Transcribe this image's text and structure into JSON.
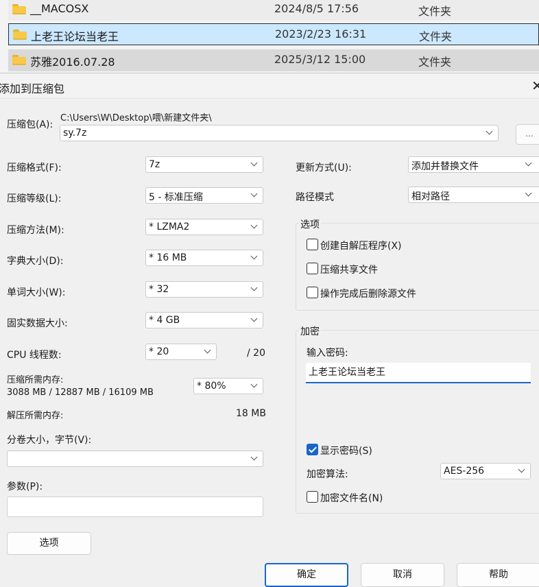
{
  "files": [
    {
      "name": "__MACOSX",
      "date": "2024/8/5 17:56",
      "type": "文件夹",
      "icon": "folder-icon"
    },
    {
      "name": "上老王论坛当老王",
      "date": "2023/2/23 16:31",
      "type": "文件夹",
      "icon": "folder-icon"
    },
    {
      "name": "苏雅2016.07.28",
      "date": "2025/3/12 15:00",
      "type": "文件夹",
      "icon": "folder-icon"
    }
  ],
  "dialog": {
    "title": "添加到压缩包",
    "close": "✕",
    "archive": {
      "label": "压缩包(A):",
      "path": "C:\\Users\\W\\Desktop\\喂\\新建文件夹\\",
      "value": "sy.7z",
      "browse": "..."
    },
    "left": {
      "format": {
        "label": "压缩格式(F):",
        "value": "7z"
      },
      "level": {
        "label": "压缩等级(L):",
        "value": "5 - 标准压缩"
      },
      "method": {
        "label": "压缩方法(M):",
        "value": "*  LZMA2"
      },
      "dict": {
        "label": "字典大小(D):",
        "value": "*  16 MB"
      },
      "word": {
        "label": "单词大小(W):",
        "value": "*  32"
      },
      "solid": {
        "label": "固实数据大小:",
        "value": "*  4 GB"
      },
      "threads": {
        "label": "CPU 线程数:",
        "value": "*  20",
        "max": "/ 20"
      },
      "mem_compress": {
        "label": "压缩所需内存:",
        "detail": "3088 MB / 12887 MB / 16109 MB",
        "value": "*  80%"
      },
      "mem_decompress": {
        "label": "解压所需内存:",
        "value": "18 MB"
      },
      "volume": {
        "label": "分卷大小，字节(V):",
        "value": ""
      },
      "params": {
        "label": "参数(P):",
        "value": ""
      },
      "options_button": "选项"
    },
    "right": {
      "update": {
        "label": "更新方式(U):",
        "value": "添加并替换文件"
      },
      "pathmode": {
        "label": "路径模式",
        "value": "相对路径"
      },
      "options_group": {
        "title": "选项",
        "sfx": {
          "label": "创建自解压程序(X)",
          "checked": false
        },
        "shared": {
          "label": "压缩共享文件",
          "checked": false
        },
        "delete": {
          "label": "操作完成后删除源文件",
          "checked": false
        }
      },
      "encryption": {
        "title": "加密",
        "password_label": "输入密码:",
        "password_value": "上老王论坛当老王",
        "show_password": {
          "label": "显示密码(S)",
          "checked": true
        },
        "method_label": "加密算法:",
        "method_value": "AES-256",
        "encrypt_names": {
          "label": "加密文件名(N)",
          "checked": false
        }
      }
    },
    "buttons": {
      "ok": "确定",
      "cancel": "取消",
      "help": "帮助"
    }
  },
  "colors": {
    "accent": "#1a64c8",
    "selection": "#cce8ff",
    "folder": "#f8c948"
  }
}
